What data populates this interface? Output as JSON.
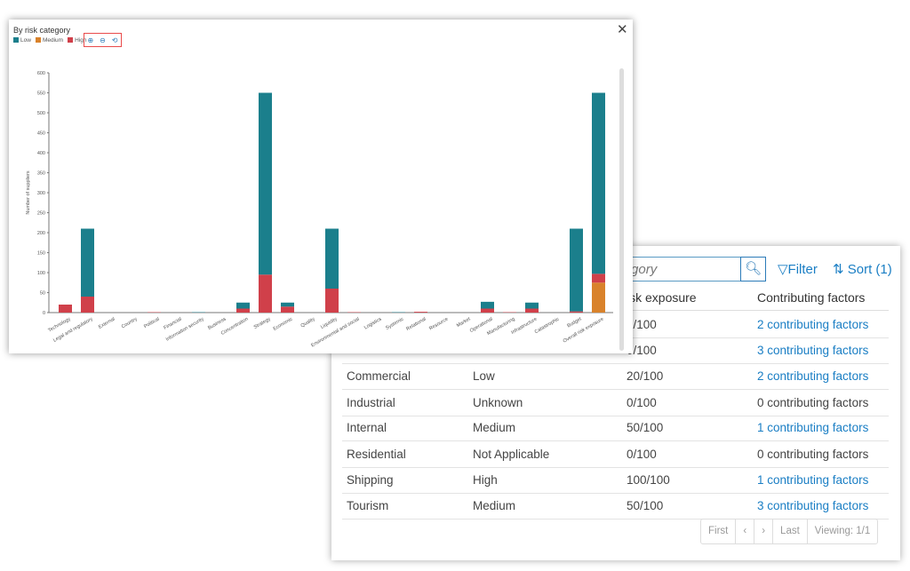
{
  "table": {
    "search_placeholder": "k category",
    "filter_label": "Filter",
    "sort_label": "Sort (1)",
    "headers": [
      "",
      "",
      "isk exposure",
      "Contributing factors"
    ],
    "rows": [
      {
        "name": "",
        "level": "",
        "exposure": "0/100",
        "factors": "2 contributing factors",
        "link": true
      },
      {
        "name": "",
        "level": "",
        "exposure": "0/100",
        "factors": "3 contributing factors",
        "link": true
      },
      {
        "name": "Commercial",
        "level": "Low",
        "exposure": "20/100",
        "factors": "2 contributing factors",
        "link": true
      },
      {
        "name": "Industrial",
        "level": "Unknown",
        "exposure": "0/100",
        "factors": "0 contributing factors",
        "link": false
      },
      {
        "name": "Internal",
        "level": "Medium",
        "exposure": "50/100",
        "factors": "1 contributing factors",
        "link": true
      },
      {
        "name": "Residential",
        "level": "Not Applicable",
        "exposure": "0/100",
        "factors": "0 contributing factors",
        "link": false
      },
      {
        "name": "Shipping",
        "level": "High",
        "exposure": "100/100",
        "factors": "1 contributing factors",
        "link": true
      },
      {
        "name": "Tourism",
        "level": "Medium",
        "exposure": "50/100",
        "factors": "3 contributing factors",
        "link": true
      }
    ],
    "pager": {
      "first": "First",
      "prev": "‹",
      "next": "›",
      "last": "Last",
      "viewing": "Viewing: 1/1"
    }
  },
  "chart_data": {
    "type": "bar",
    "stacked": true,
    "title": "By risk category",
    "ylabel": "Number of suppliers",
    "xlabel": "",
    "ylim": [
      0,
      600
    ],
    "yticks": [
      0,
      50,
      100,
      150,
      200,
      250,
      300,
      350,
      400,
      450,
      500,
      550,
      600
    ],
    "legend_position": "top-left",
    "colors": {
      "Low": "#1b7f8c",
      "Medium": "#d9822b",
      "High": "#d0404a"
    },
    "categories": [
      "Technology",
      "Legal and regulatory",
      "External",
      "Country",
      "Political",
      "Financial",
      "Information security",
      "Business",
      "Concentration",
      "Strategy",
      "Economic",
      "Quality",
      "Liquidity",
      "Environmental and social",
      "Logistics",
      "Systemic",
      "Relational",
      "Resource",
      "Market",
      "Operational",
      "Manufacturing",
      "Infrastructure",
      "Catastrophic",
      "Budget",
      "Overall risk exposure"
    ],
    "series": [
      {
        "name": "High",
        "values": [
          20,
          40,
          0,
          0,
          1,
          0,
          0,
          0,
          10,
          95,
          15,
          0,
          60,
          1,
          0,
          0,
          2,
          0,
          0,
          10,
          1,
          10,
          0,
          3,
          22
        ]
      },
      {
        "name": "Medium",
        "values": [
          0,
          0,
          0,
          0,
          0,
          0,
          0,
          0,
          0,
          0,
          0,
          0,
          0,
          0,
          0,
          0,
          0,
          0,
          0,
          0,
          0,
          0,
          0,
          0,
          75
        ]
      },
      {
        "name": "Low",
        "values": [
          0,
          170,
          0,
          0,
          0,
          0,
          1,
          0,
          15,
          455,
          10,
          0,
          150,
          0,
          0,
          1,
          0,
          0,
          0,
          17,
          0,
          15,
          0,
          207,
          453
        ]
      }
    ]
  },
  "ui": {
    "close": "✕",
    "zoom_in": "⊕",
    "zoom_out": "⊖",
    "reset": "⟲",
    "search_icon": "⌕"
  }
}
